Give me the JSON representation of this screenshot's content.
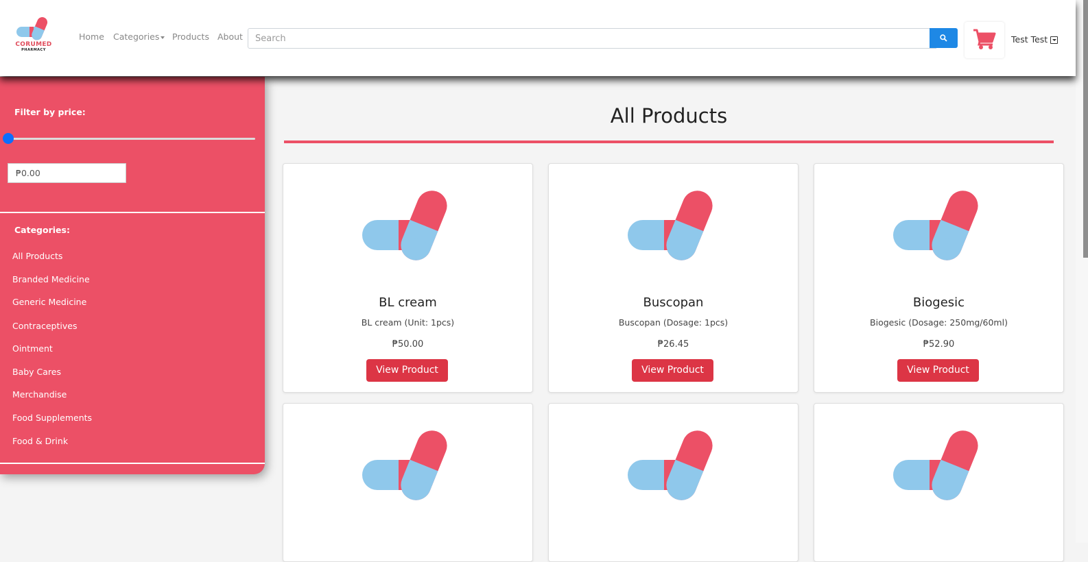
{
  "brand": {
    "name": "CORUMED",
    "tagline": "PHARMACY"
  },
  "nav": {
    "home": "Home",
    "categories": "Categories",
    "products": "Products",
    "about": "About"
  },
  "search": {
    "placeholder": "Search",
    "button_icon": "search-icon"
  },
  "cart": {
    "icon": "shopping-cart-icon"
  },
  "user": {
    "name": "Test Test"
  },
  "colors": {
    "primary": "#ec5066",
    "button": "#dc3545",
    "search": "#1e88e5",
    "pill_blue": "#8fc8eb"
  },
  "sidebar": {
    "filter_heading": "Filter by price:",
    "price_value": "₱0.00",
    "price_slider_fraction": 0,
    "categories_heading": "Categories:",
    "categories": [
      "All Products",
      "Branded Medicine",
      "Generic Medicine",
      "Contraceptives",
      "Ointment",
      "Baby Cares",
      "Merchandise",
      "Food Supplements",
      "Food & Drink"
    ]
  },
  "main": {
    "title": "All Products",
    "products": [
      {
        "name": "BL cream",
        "desc": "BL cream (Unit: 1pcs)",
        "price": "₱50.00",
        "button": "View Product"
      },
      {
        "name": "Buscopan",
        "desc": "Buscopan (Dosage: 1pcs)",
        "price": "₱26.45",
        "button": "View Product"
      },
      {
        "name": "Biogesic",
        "desc": "Biogesic (Dosage: 250mg/60ml)",
        "price": "₱52.90",
        "button": "View Product"
      }
    ]
  }
}
